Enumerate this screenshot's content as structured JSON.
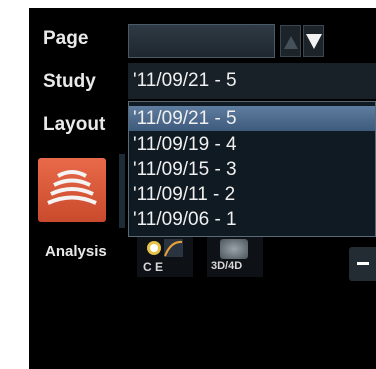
{
  "labels": {
    "page": "Page",
    "study": "Study",
    "layout": "Layout",
    "analysis": "Analysis"
  },
  "study": {
    "value": "'11/09/21 - 5",
    "options": [
      "'11/09/21 - 5",
      "'11/09/19 - 4",
      "'11/09/15 - 3",
      "'11/09/11 - 2",
      "'11/09/06 - 1"
    ],
    "selected_index": 0
  },
  "analysis_buttons": {
    "ce": "C E",
    "d3d4": "3D/4D"
  },
  "icons": {
    "page_up": "triangle-up-icon",
    "page_down": "triangle-down-icon",
    "probe": "ultrasound-probe-icon",
    "ce": "contrast-curve-icon",
    "d3d4": "3d4d-volume-icon",
    "side": "minus-icon"
  },
  "colors": {
    "background": "#000000",
    "selection": "#4f6d90",
    "probe": "#d9583a"
  }
}
